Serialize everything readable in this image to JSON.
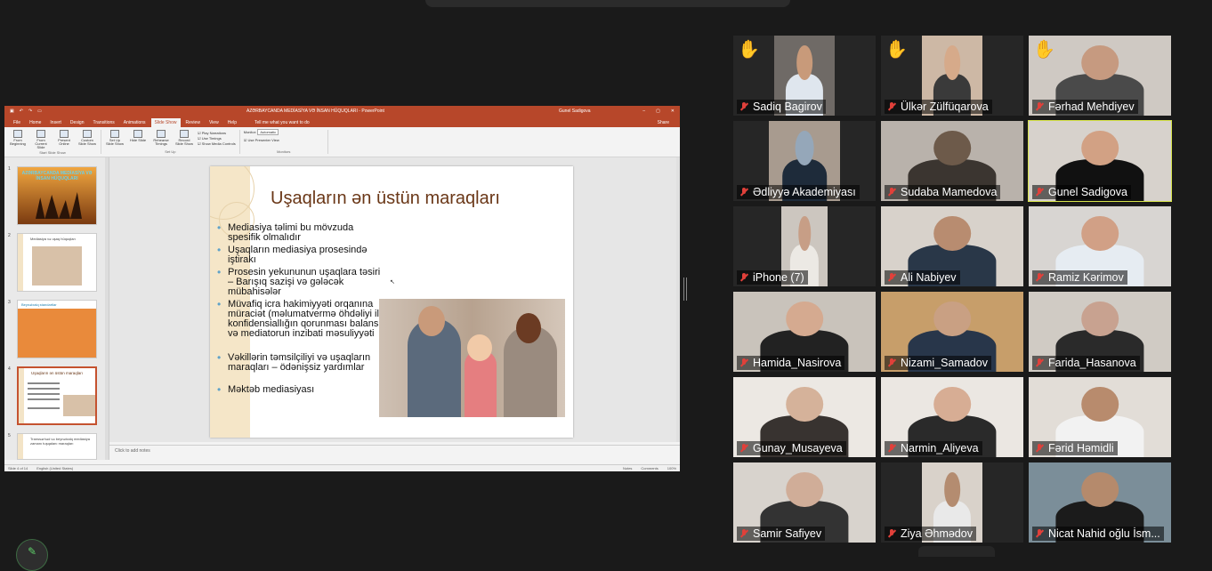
{
  "powerpoint": {
    "doc_title": "AZƏRBAYCANDA MEDİASİYA VƏ İNSAN HÜQUQLARI  -  PowerPoint",
    "user": "Gunel Sadigova",
    "tabs": [
      "File",
      "Home",
      "Insert",
      "Design",
      "Transitions",
      "Animations",
      "Slide Show",
      "Review",
      "View",
      "Help"
    ],
    "active_tab": "Slide Show",
    "tell_me": "Tell me what you want to do",
    "share_label": "Share",
    "ribbon": {
      "start_group": "Start Slide Show",
      "from_beginning": "From Beginning",
      "from_current": "From Current Slide",
      "present_online": "Present Online",
      "custom_show": "Custom Slide Show",
      "setup_group": "Set Up",
      "setup_show": "Set Up Slide Show",
      "hide_slide": "Hide Slide",
      "rehearse": "Rehearse Timings",
      "record": "Record Slide Show",
      "play_narrations": "Play Narrations",
      "use_timings": "Use Timings",
      "show_media_controls": "Show Media Controls",
      "monitors_group": "Monitors",
      "monitor_label": "Monitor:",
      "monitor_value": "Automatic",
      "use_presenter_view": "Use Presenter View"
    },
    "thumbnails": [
      {
        "num": "1",
        "caption": "AZƏRBAYCANDA MEDİASİYA VƏ İNSAN HÜQUQLARI"
      },
      {
        "num": "2",
        "caption": "Mediasiya və uşaq hüquqları"
      },
      {
        "num": "3",
        "caption": "Beynəlxalq standartlar"
      },
      {
        "num": "4",
        "caption": "Uşaqların ən üstün maraqları"
      },
      {
        "num": "5",
        "caption": "Transsərhəd və beynəlxalq mediasiya zamanı tuşqalanı maraqları"
      }
    ],
    "slide": {
      "title": "Uşaqların ən üstün maraqları",
      "bullets": [
        "Mediasiya təlimi bu mövzuda spesifik olmalıdır",
        "Uşaqların mediasiya prosesində iştirakı",
        "Prosesin yekununun uşaqlara təsiri – Barışıq sazişi və gələcək mübahisələr",
        "Müvafiq icra hakimiyyəti orqanına müraciət (məlumatvermə öhdəliyi ilə konfidensiallığın qorunması balansı) və mediatorun inzibati məsuliyyəti",
        "Vəkillərin təmsilçiliyi və uşaqların maraqları – ödənişsiz yardımlar",
        "Məktəb mediasiyası"
      ]
    },
    "notes_placeholder": "Click to add notes",
    "status": {
      "slide_counter": "Slide 4 of 14",
      "language": "English (United States)",
      "notes": "Notes",
      "comments": "Comments",
      "zoom": "100%"
    }
  },
  "participants": [
    {
      "name": "Sadiq Bagirov",
      "hand": true
    },
    {
      "name": "Ülkər Zülfüqarova",
      "hand": true
    },
    {
      "name": "Fərhad Mehdiyev",
      "hand": true
    },
    {
      "name": "Ədliyyə Akademiyası",
      "hand": false
    },
    {
      "name": "Sudaba Mamedova",
      "hand": false
    },
    {
      "name": "Gunel Sadigova",
      "hand": false
    },
    {
      "name": "iPhone (7)",
      "hand": false
    },
    {
      "name": "Ali Nabiyev",
      "hand": false
    },
    {
      "name": "Ramiz Kərimov",
      "hand": false
    },
    {
      "name": "Hamida_Nasirova",
      "hand": false
    },
    {
      "name": "Nizami_Samadov",
      "hand": false
    },
    {
      "name": "Farida_Hasanova",
      "hand": false
    },
    {
      "name": "Gunay_Musayeva",
      "hand": false
    },
    {
      "name": "Narmin_Aliyeva",
      "hand": false
    },
    {
      "name": "Fərid Həmidli",
      "hand": false
    },
    {
      "name": "Samir Safiyev",
      "hand": false
    },
    {
      "name": "Ziya Əhmədov",
      "hand": false
    },
    {
      "name": "Nicat Nahid oğlu İsm...",
      "hand": false
    }
  ],
  "colors": {
    "powerpoint_accent": "#b7472a",
    "active_speaker": "#d7e34b",
    "muted_mic": "#e0403a",
    "raised_hand": "#f5b82e"
  },
  "icons": {
    "hand": "raised-hand-icon",
    "mic": "muted-mic-icon",
    "bottom_button": "pencil-icon"
  }
}
